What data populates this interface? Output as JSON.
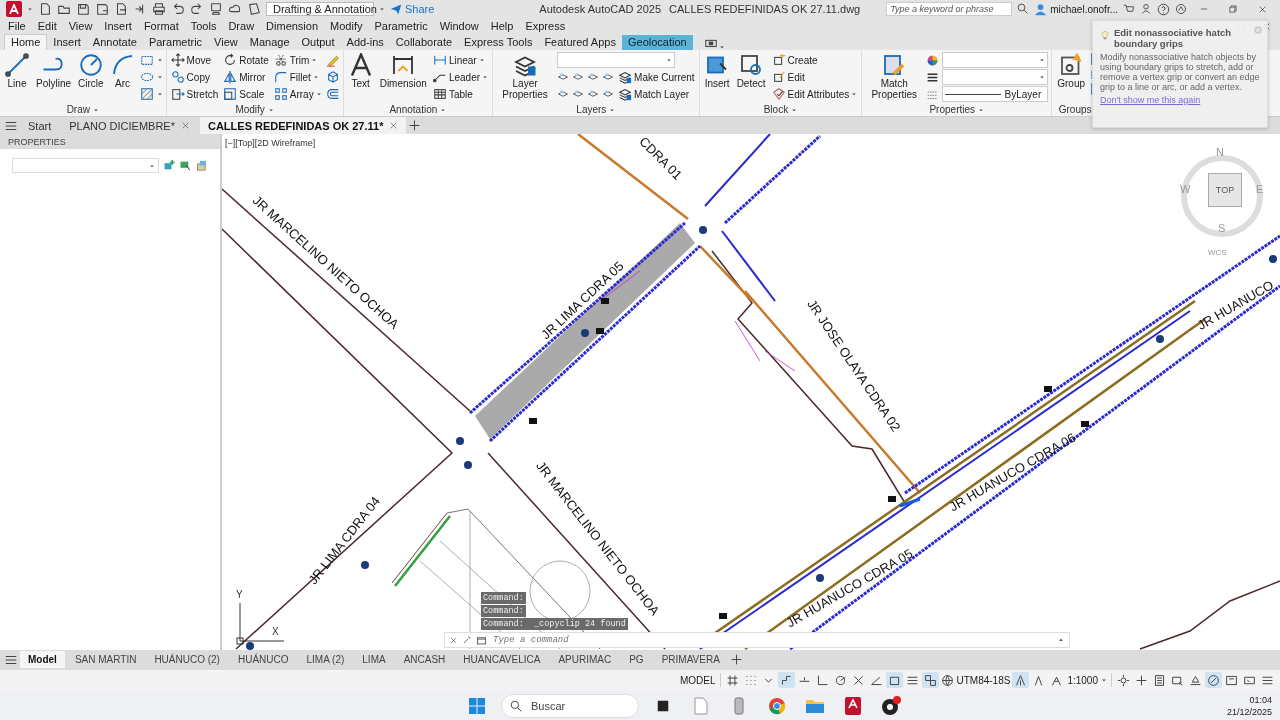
{
  "title_bar": {
    "workspace": "Drafting & Annotation",
    "share": "Share",
    "app": "Autodesk AutoCAD 2025",
    "file": "CALLES REDEFINIDAS OK 27.11.dwg",
    "search": {
      "placeholder": "Type a keyword or phrase"
    },
    "user": "michael.onofr..."
  },
  "menu": [
    "File",
    "Edit",
    "View",
    "Insert",
    "Format",
    "Tools",
    "Draw",
    "Dimension",
    "Modify",
    "Parametric",
    "Window",
    "Help",
    "Express"
  ],
  "ribbon_tabs": [
    {
      "label": "Home",
      "selected": true,
      "kind": "normal"
    },
    {
      "label": "Insert",
      "selected": false,
      "kind": "normal"
    },
    {
      "label": "Annotate",
      "selected": false,
      "kind": "normal"
    },
    {
      "label": "Parametric",
      "selected": false,
      "kind": "normal"
    },
    {
      "label": "View",
      "selected": false,
      "kind": "normal"
    },
    {
      "label": "Manage",
      "selected": false,
      "kind": "normal"
    },
    {
      "label": "Output",
      "selected": false,
      "kind": "normal"
    },
    {
      "label": "Add-ins",
      "selected": false,
      "kind": "normal"
    },
    {
      "label": "Collaborate",
      "selected": false,
      "kind": "normal"
    },
    {
      "label": "Express Tools",
      "selected": false,
      "kind": "normal"
    },
    {
      "label": "Featured Apps",
      "selected": false,
      "kind": "normal"
    },
    {
      "label": "Geolocation",
      "selected": false,
      "kind": "contextual"
    }
  ],
  "ribbon_panels": [
    {
      "title": "Draw",
      "kind": "draw",
      "large": [
        "Line",
        "Polyline",
        "Circle",
        "Arc"
      ]
    },
    {
      "title": "Modify",
      "kind": "modify",
      "rows": [
        [
          "Move",
          "Rotate",
          "Trim"
        ],
        [
          "Copy",
          "Mirror",
          "Fillet"
        ],
        [
          "Stretch",
          "Scale",
          "Array"
        ]
      ]
    },
    {
      "title": "Annotation",
      "kind": "annotation",
      "large": [
        "Text",
        "Dimension"
      ],
      "small": [
        "Linear",
        "Leader",
        "Table"
      ]
    },
    {
      "title": "Layers",
      "kind": "layers",
      "large": [
        "Layer Properties"
      ],
      "small": [
        "Make Current",
        "Match Layer"
      ]
    },
    {
      "title": "Block",
      "kind": "block",
      "large": [
        "Insert",
        "Detect"
      ],
      "small": [
        "Create",
        "Edit",
        "Edit Attributes"
      ]
    },
    {
      "title": "Properties",
      "kind": "properties",
      "large": [
        "Match Properties"
      ],
      "linetype": "ByLayer"
    },
    {
      "title": "Groups",
      "kind": "groups",
      "large": [
        "Group"
      ]
    }
  ],
  "tooltip": {
    "title": "Edit nonassociative hatch boundary grips",
    "body": "Modify nonassociative hatch objects by using boundary grips to stretch, add or remove a vertex grip or convert an edge grip to a line or arc, or add a vertex.",
    "link": "Don't show me this again"
  },
  "file_tabs": [
    {
      "label": "Start",
      "selected": false,
      "closable": false
    },
    {
      "label": "PLANO DICIEMBRE*",
      "selected": false,
      "closable": true
    },
    {
      "label": "CALLES REDEFINIDAS OK 27.11*",
      "selected": true,
      "closable": true
    }
  ],
  "palette": {
    "title": "PROPERTIES"
  },
  "viewport": {
    "label": "[−][Top][2D Wireframe]",
    "viewcube": {
      "north": "N",
      "west": "W",
      "east": "E",
      "south": "S",
      "face": "TOP",
      "ucs": "WCS"
    },
    "ucs_axes": {
      "x": "X",
      "y": "Y"
    },
    "street_labels": [
      "JR MARCELINO NIETO OCHOA",
      "CDRA 01",
      "JR LIMA CDRA 05",
      "JR JOSE OLAYA CDRA 02",
      "JR HUANUCO",
      "JR HUANUCO CDRA 06",
      "JR MARCELINO NIETO OCHOA",
      "JR LIMA CDRA 04",
      "JR HUANUCO CDRA 05"
    ],
    "command_history": [
      "Command:",
      "Command:",
      "Command:  _copyclip 24 found"
    ],
    "command": {
      "placeholder": "Type a command"
    }
  },
  "layout_tabs": [
    {
      "label": "Model",
      "selected": true
    },
    {
      "label": "SAN MARTIN",
      "selected": false
    },
    {
      "label": "HUÁNUCO (2)",
      "selected": false
    },
    {
      "label": "HUÁNUCO",
      "selected": false
    },
    {
      "label": "LIMA (2)",
      "selected": false
    },
    {
      "label": "LIMA",
      "selected": false
    },
    {
      "label": "ANCASH",
      "selected": false
    },
    {
      "label": "HUANCAVELICA",
      "selected": false
    },
    {
      "label": "APURIMAC",
      "selected": false
    },
    {
      "label": "PG",
      "selected": false
    },
    {
      "label": "PRIMAVERA",
      "selected": false
    }
  ],
  "status_bar": {
    "model": "MODEL",
    "toggles_a": [
      {
        "on": false
      },
      {
        "on": false
      },
      {
        "on": false
      },
      {
        "on": true
      },
      {
        "on": false
      },
      {
        "on": false
      },
      {
        "on": false
      },
      {
        "on": false
      },
      {
        "on": false
      },
      {
        "on": true
      },
      {
        "on": false
      },
      {
        "on": true
      }
    ],
    "coordinate_system": "UTM84-18S",
    "toggles_b": [
      {
        "on": true
      },
      {
        "on": false
      },
      {
        "on": false
      }
    ],
    "scale": "1:1000",
    "toggles_c": [
      {
        "on": false
      },
      {
        "on": false
      },
      {
        "on": false
      },
      {
        "on": false
      },
      {
        "on": false
      },
      {
        "on": true
      },
      {
        "on": false
      },
      {
        "on": false
      },
      {
        "on": false
      }
    ]
  },
  "taskbar": {
    "search": {
      "placeholder": "Buscar"
    },
    "time": "01:04",
    "date": "21/12/2025"
  }
}
